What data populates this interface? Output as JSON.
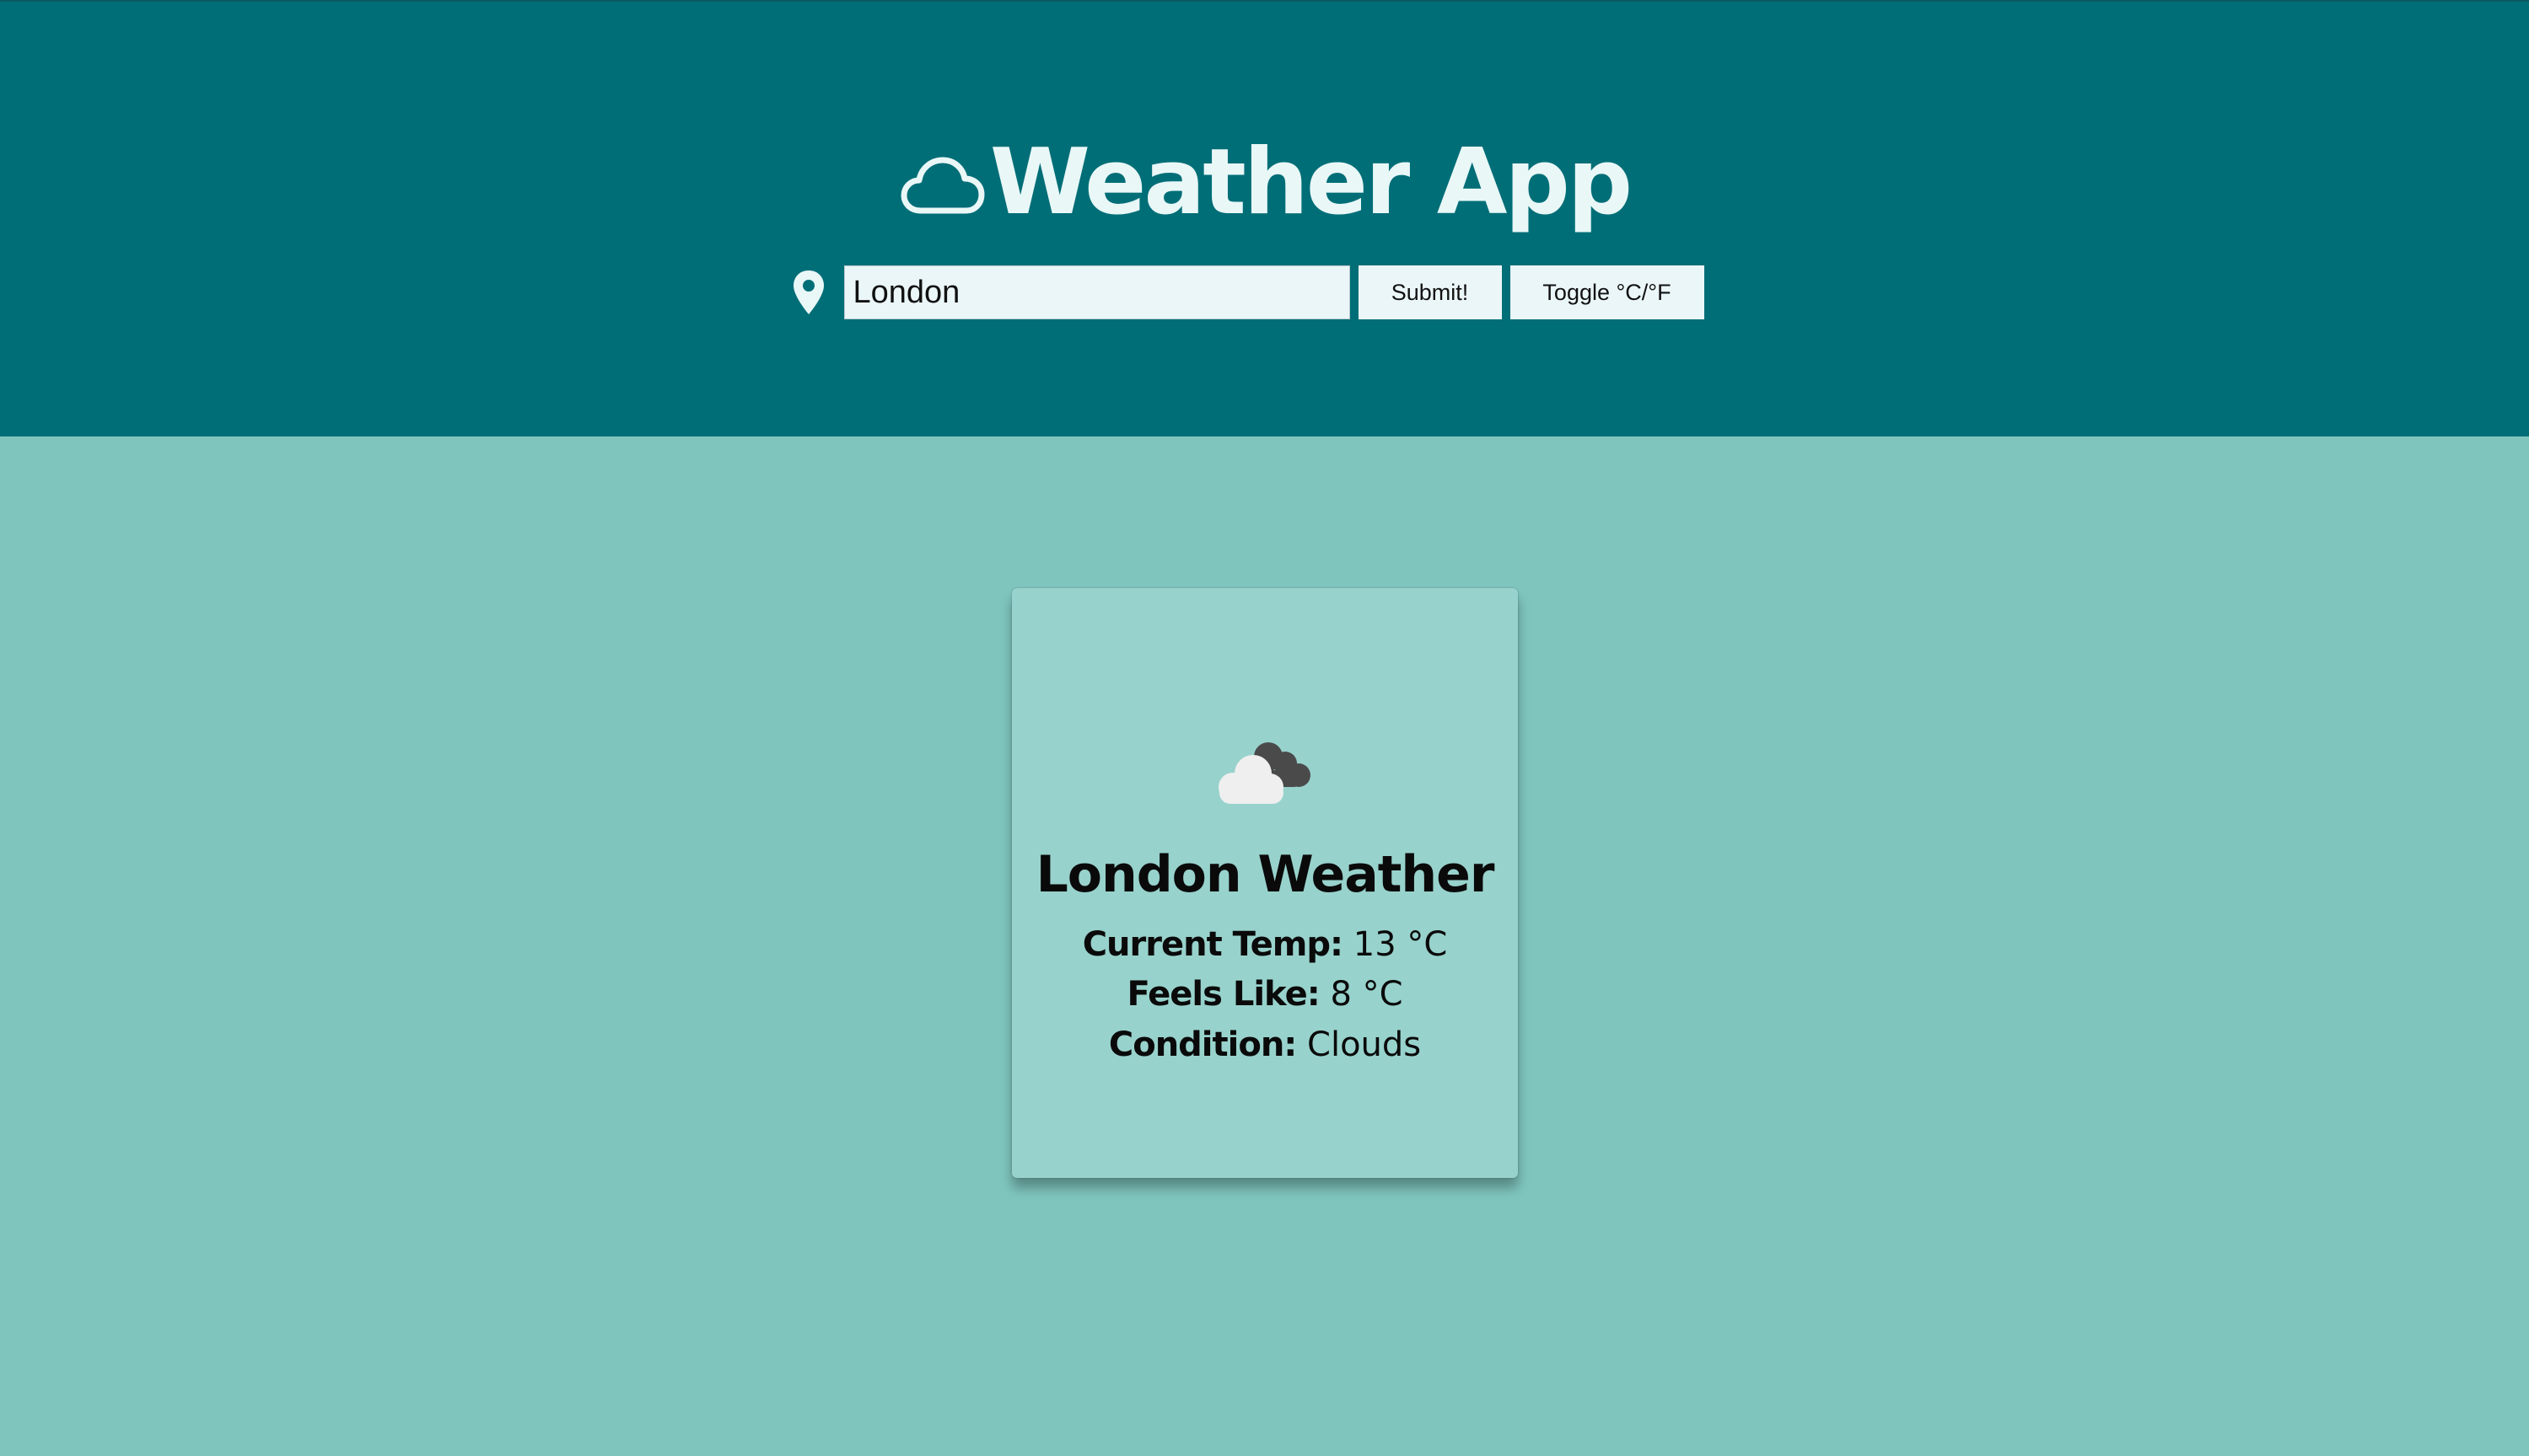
{
  "header": {
    "title": "Weather App",
    "title_icon": "cloud-outline-icon",
    "location_icon": "map-pin-icon",
    "search": {
      "value": "London",
      "placeholder": ""
    },
    "submit_label": "Submit!",
    "toggle_label": "Toggle °C/°F"
  },
  "card": {
    "icon": "partly-cloudy-icon",
    "title": "London Weather",
    "current_temp_label": "Current Temp:",
    "current_temp_value": "13 °C",
    "feels_like_label": "Feels Like:",
    "feels_like_value": "8 °C",
    "condition_label": "Condition:",
    "condition_value": "Clouds"
  },
  "colors": {
    "header_bg": "#006e77",
    "page_bg": "#7fc5be",
    "card_bg": "#98d2cc",
    "header_text": "#e9f7f7"
  }
}
